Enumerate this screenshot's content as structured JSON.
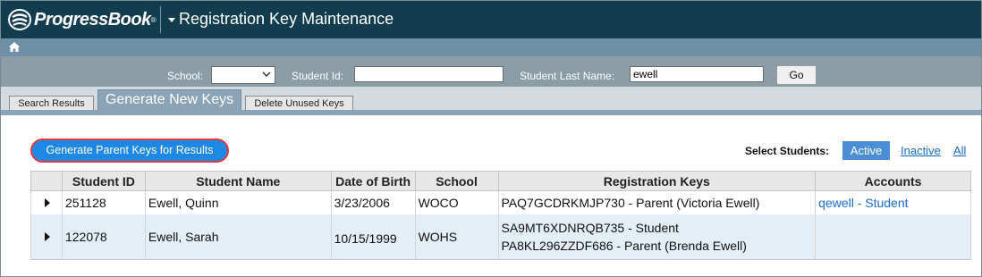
{
  "app": {
    "brand": "ProgressBook",
    "page_title": "Registration Key Maintenance"
  },
  "search": {
    "school_label": "School:",
    "school_value": "",
    "student_id_label": "Student Id:",
    "student_id_value": "",
    "last_name_label": "Student Last Name:",
    "last_name_value": "ewell",
    "go_label": "Go"
  },
  "tabs": [
    {
      "label": "Search Results",
      "active": false
    },
    {
      "label": "Generate New Keys",
      "active": true
    },
    {
      "label": "Delete Unused Keys",
      "active": false
    }
  ],
  "actions": {
    "generate_label": "Generate Parent Keys for Results",
    "select_students_label": "Select Students:",
    "filter_active": "Active",
    "filter_inactive": "Inactive",
    "filter_all": "All"
  },
  "table": {
    "headers": [
      "",
      "Student ID",
      "Student Name",
      "Date of Birth",
      "School",
      "Registration Keys",
      "Accounts"
    ],
    "rows": [
      {
        "student_id": "251128",
        "name": "Ewell, Quinn",
        "dob": "3/23/2006",
        "school": "WOCO",
        "keys": [
          "PAQ7GCDRKMJP730 - Parent (Victoria Ewell)"
        ],
        "account": "qewell - Student"
      },
      {
        "student_id": "122078",
        "name": "Ewell, Sarah",
        "dob": "10/15/1999",
        "school": "WOHS",
        "keys": [
          "SA9MT6XDNRQB735 - Student",
          "PA8KL296ZZDF686 - Parent (Brenda Ewell)"
        ],
        "account": ""
      }
    ]
  },
  "colors": {
    "topbar": "#123d4f",
    "navbar": "#6f8fa6",
    "searchbar": "#8b9da7",
    "accent_button": "#1e88e5",
    "highlight_ring": "#e23a3a",
    "active_pill": "#4a8fd6",
    "link": "#1a6cc8"
  },
  "icons": {
    "logo": "progressbook-logo-icon",
    "home": "home-icon",
    "menu_caret": "caret-down-icon",
    "select_chevron": "chevron-down-icon",
    "row_expand": "expand-arrow-icon"
  }
}
